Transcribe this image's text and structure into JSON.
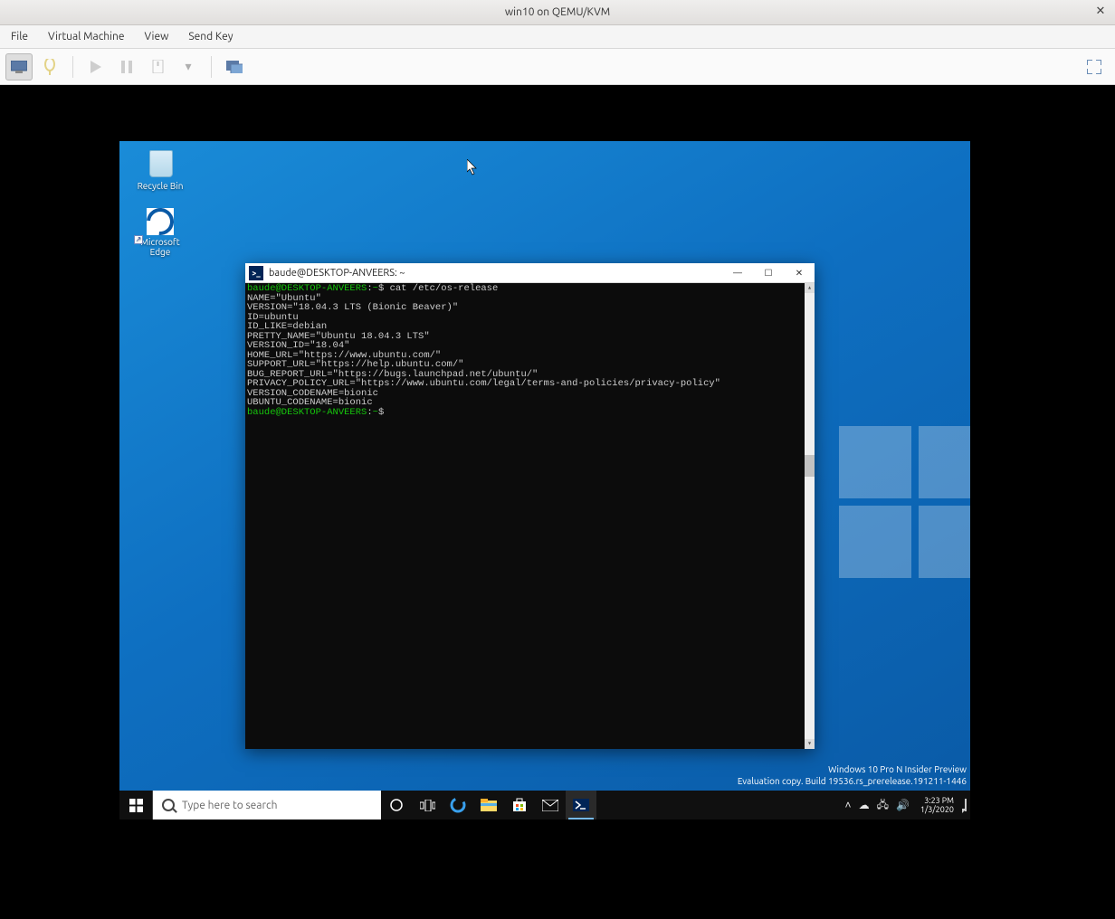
{
  "host": {
    "title": "win10 on QEMU/KVM",
    "menu": {
      "file": "File",
      "vm": "Virtual Machine",
      "view": "View",
      "sendkey": "Send Key"
    }
  },
  "windows": {
    "desktop_icons": {
      "recycle": "Recycle Bin",
      "edge": "Microsoft\nEdge"
    },
    "watermark": {
      "line1": "Windows 10 Pro N Insider Preview",
      "line2": "Evaluation copy. Build 19536.rs_prerelease.191211-1446"
    },
    "search_placeholder": "Type here to search",
    "tray": {
      "time": "3:23 PM",
      "date": "1/3/2020"
    }
  },
  "terminal": {
    "title": "baude@DESKTOP-ANVEERS: ~",
    "prompt_user": "baude@DESKTOP-ANVEERS",
    "prompt_path": "~",
    "cmd": "cat /etc/os-release",
    "output": [
      "NAME=\"Ubuntu\"",
      "VERSION=\"18.04.3 LTS (Bionic Beaver)\"",
      "ID=ubuntu",
      "ID_LIKE=debian",
      "PRETTY_NAME=\"Ubuntu 18.04.3 LTS\"",
      "VERSION_ID=\"18.04\"",
      "HOME_URL=\"https://www.ubuntu.com/\"",
      "SUPPORT_URL=\"https://help.ubuntu.com/\"",
      "BUG_REPORT_URL=\"https://bugs.launchpad.net/ubuntu/\"",
      "PRIVACY_POLICY_URL=\"https://www.ubuntu.com/legal/terms-and-policies/privacy-policy\"",
      "VERSION_CODENAME=bionic",
      "UBUNTU_CODENAME=bionic"
    ]
  }
}
